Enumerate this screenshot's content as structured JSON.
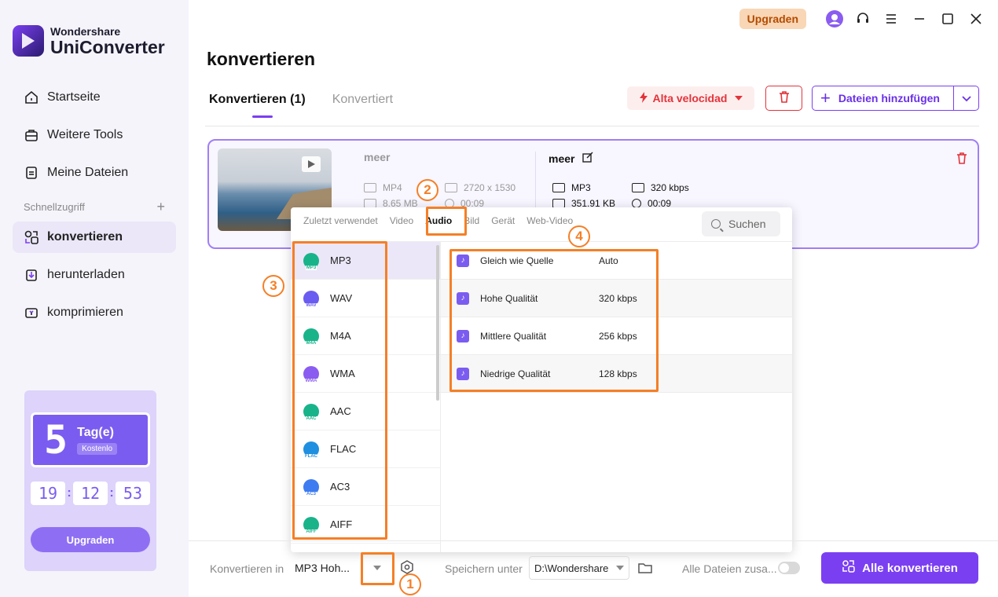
{
  "app": {
    "brand_small": "Wondershare",
    "brand_big": "UniConverter"
  },
  "sidebar": {
    "items": [
      {
        "label": "Startseite",
        "icon": "home-icon"
      },
      {
        "label": "Weitere Tools",
        "icon": "toolbox-icon"
      },
      {
        "label": "Meine Dateien",
        "icon": "file-icon"
      }
    ],
    "section_label": "Schnellzugriff",
    "quick": [
      {
        "label": "konvertieren",
        "icon": "convert-icon",
        "active": true
      },
      {
        "label": "herunterladen",
        "icon": "download-icon"
      },
      {
        "label": "komprimieren",
        "icon": "compress-icon"
      }
    ]
  },
  "promo": {
    "number": "5",
    "days": "Tag(e)",
    "free": "Kostenlo",
    "timer": [
      "19",
      "12",
      "53"
    ],
    "button": "Upgraden"
  },
  "topbar": {
    "upgrade": "Upgraden"
  },
  "page_title": "konvertieren",
  "tabs": [
    {
      "label": "Konvertieren (1)",
      "active": true
    },
    {
      "label": "Konvertiert"
    }
  ],
  "toolbar": {
    "speed": "Alta velocidad",
    "add_files": "Dateien hinzufügen"
  },
  "file": {
    "source": {
      "name": "meer",
      "format": "MP4",
      "resolution": "2720 x 1530",
      "size": "8.65 MB",
      "duration": "00:09"
    },
    "target": {
      "name": "meer",
      "format": "MP3",
      "bitrate": "320 kbps",
      "size": "351.91 KB",
      "duration": "00:09"
    }
  },
  "popup": {
    "tabs": [
      "Zuletzt verwendet",
      "Video",
      "Audio",
      "Bild",
      "Gerät",
      "Web-Video"
    ],
    "active_tab": "Audio",
    "search_label": "Suchen",
    "formats": [
      {
        "name": "MP3",
        "color": "#19b38a"
      },
      {
        "name": "WAV",
        "color": "#6a5cf0"
      },
      {
        "name": "M4A",
        "color": "#19b38a"
      },
      {
        "name": "WMA",
        "color": "#8a5cf0"
      },
      {
        "name": "AAC",
        "color": "#19b38a"
      },
      {
        "name": "FLAC",
        "color": "#1f8fe0"
      },
      {
        "name": "AC3",
        "color": "#3d7bf0"
      },
      {
        "name": "AIFF",
        "color": "#19b38a"
      }
    ],
    "qualities": [
      {
        "name": "Gleich wie Quelle",
        "value": "Auto"
      },
      {
        "name": "Hohe Qualität",
        "value": "320 kbps"
      },
      {
        "name": "Mittlere Qualität",
        "value": "256 kbps"
      },
      {
        "name": "Niedrige Qualität",
        "value": "128 kbps"
      }
    ]
  },
  "bottom": {
    "convert_in_label": "Konvertieren in",
    "convert_in_value": "MP3 Hoh...",
    "save_label": "Speichern unter",
    "save_value": "D:\\Wondershare",
    "merge_label": "Alle Dateien zusa...",
    "convert_all": "Alle konvertieren"
  },
  "annotations": [
    "1",
    "2",
    "3",
    "4"
  ],
  "colors": {
    "accent": "#7b3ff2",
    "annotation": "#f57f26",
    "danger": "#e2343b"
  }
}
